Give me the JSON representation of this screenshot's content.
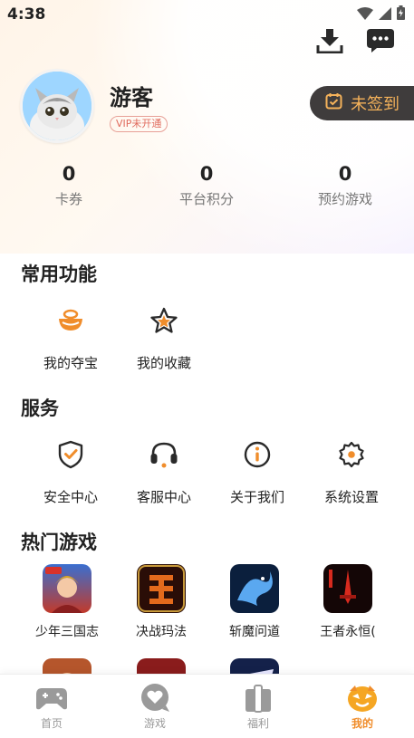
{
  "status_bar": {
    "time": "4:38"
  },
  "profile": {
    "username": "游客",
    "vip_status": "VIP未开通",
    "checkin_label": "未签到"
  },
  "stats": [
    {
      "value": "0",
      "label": "卡券"
    },
    {
      "value": "0",
      "label": "平台积分"
    },
    {
      "value": "0",
      "label": "预约游戏"
    }
  ],
  "sections": {
    "common": {
      "title": "常用功能",
      "items": [
        {
          "label": "我的夺宝",
          "icon": "treasure-bowl-icon"
        },
        {
          "label": "我的收藏",
          "icon": "star-icon"
        }
      ]
    },
    "service": {
      "title": "服务",
      "items": [
        {
          "label": "安全中心",
          "icon": "shield-check-icon"
        },
        {
          "label": "客服中心",
          "icon": "headset-icon"
        },
        {
          "label": "关于我们",
          "icon": "info-icon"
        },
        {
          "label": "系统设置",
          "icon": "gear-icon"
        }
      ]
    },
    "hot_games": {
      "title": "热门游戏",
      "games": [
        {
          "name": "少年三国志",
          "icon": "game-warrior-icon"
        },
        {
          "name": "决战玛法",
          "icon": "game-dragon-glyph-icon"
        },
        {
          "name": "斩魔问道",
          "icon": "game-blue-dragon-icon"
        },
        {
          "name": "王者永恒(",
          "icon": "game-red-sword-icon"
        }
      ]
    }
  },
  "bottom_nav": [
    {
      "label": "首页",
      "icon": "gamepad-icon",
      "active": false
    },
    {
      "label": "游戏",
      "icon": "heart-bubble-icon",
      "active": false
    },
    {
      "label": "福利",
      "icon": "gift-box-icon",
      "active": false
    },
    {
      "label": "我的",
      "icon": "mascot-face-icon",
      "active": true
    }
  ],
  "colors": {
    "accent": "#f08d2b",
    "checkin_bg": "#3f3c3c",
    "checkin_text": "#f5b25a",
    "vip_text": "#e06b5d"
  }
}
